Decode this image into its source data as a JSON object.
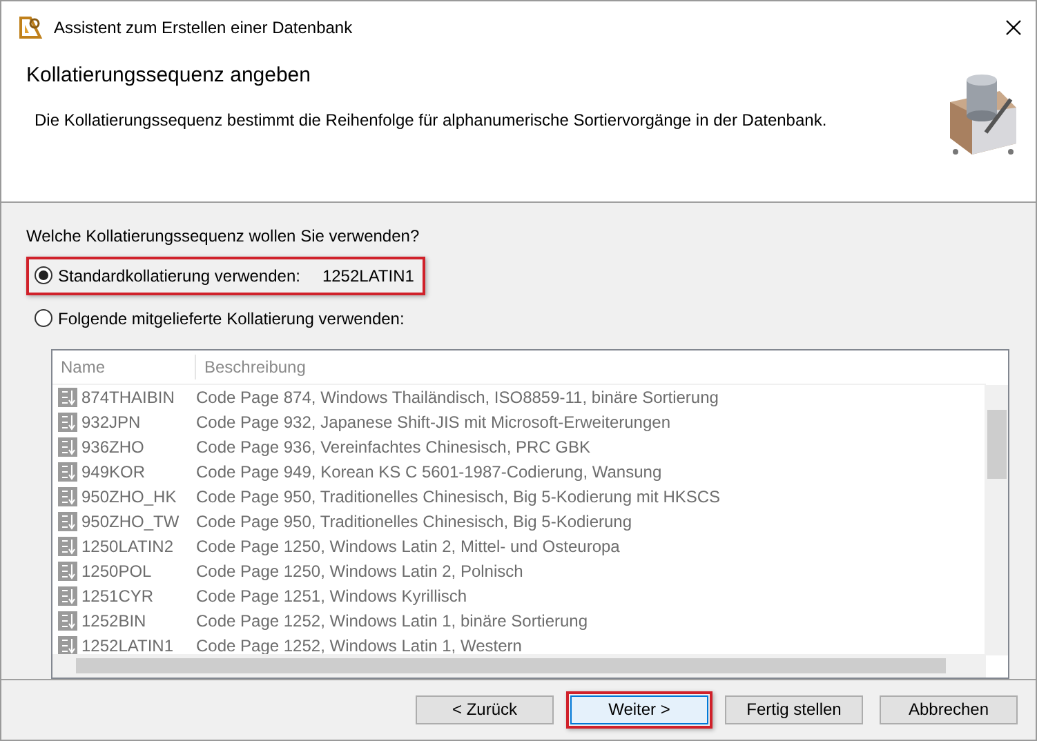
{
  "window": {
    "title": "Assistent zum Erstellen einer Datenbank"
  },
  "header": {
    "title": "Kollatierungssequenz angeben",
    "description": "Die Kollatierungssequenz bestimmt die Reihenfolge für alphanumerische Sortiervorgänge in der Datenbank."
  },
  "question": "Welche Kollatierungssequenz wollen Sie verwenden?",
  "options": [
    {
      "label": "Standardkollatierung verwenden:",
      "value": "1252LATIN1",
      "selected": true,
      "highlighted": true
    },
    {
      "label": "Folgende mitgelieferte Kollatierung verwenden:",
      "selected": false,
      "highlighted": false
    }
  ],
  "table": {
    "disabled": true,
    "columns": [
      "Name",
      "Beschreibung"
    ],
    "rows": [
      {
        "name": "874THAIBIN",
        "description": "Code Page 874, Windows Thailändisch, ISO8859-11, binäre Sortierung"
      },
      {
        "name": "932JPN",
        "description": "Code Page 932, Japanese Shift-JIS mit Microsoft-Erweiterungen"
      },
      {
        "name": "936ZHO",
        "description": "Code Page 936, Vereinfachtes Chinesisch, PRC GBK"
      },
      {
        "name": "949KOR",
        "description": "Code Page 949, Korean KS C 5601-1987-Codierung, Wansung"
      },
      {
        "name": "950ZHO_HK",
        "description": "Code Page 950, Traditionelles Chinesisch, Big 5-Kodierung mit HKSCS"
      },
      {
        "name": "950ZHO_TW",
        "description": "Code Page 950, Traditionelles Chinesisch, Big 5-Kodierung"
      },
      {
        "name": "1250LATIN2",
        "description": "Code Page 1250, Windows Latin 2, Mittel- und Osteuropa"
      },
      {
        "name": "1250POL",
        "description": "Code Page 1250, Windows Latin 2, Polnisch"
      },
      {
        "name": "1251CYR",
        "description": "Code Page 1251, Windows Kyrillisch"
      },
      {
        "name": "1252BIN",
        "description": "Code Page 1252, Windows Latin 1, binäre Sortierung"
      },
      {
        "name": "1252LATIN1",
        "description": "Code Page 1252, Windows Latin 1, Western"
      }
    ]
  },
  "buttons": [
    {
      "label": "< Zurück",
      "highlighted": false,
      "focused": false
    },
    {
      "label": "Weiter >",
      "highlighted": true,
      "focused": true
    },
    {
      "label": "Fertig stellen",
      "highlighted": false,
      "focused": false
    },
    {
      "label": "Abbrechen",
      "highlighted": false,
      "focused": false
    }
  ]
}
